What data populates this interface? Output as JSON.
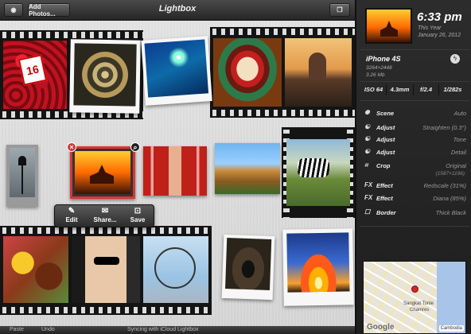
{
  "topbar": {
    "title": "Lightbox",
    "add_photos_label": "Add Photos...",
    "camera_icon": "camera-icon",
    "window_icon": "windows-icon"
  },
  "toolbar": {
    "edit_label": "Edit",
    "share_label": "Share...",
    "save_label": "Save"
  },
  "bottombar": {
    "paste_label": "Paste",
    "undo_label": "Undo",
    "sync_text": "Syncing with iCloud Lightbox"
  },
  "sidebar": {
    "time": "6:33 pm",
    "date_line1": "This Year",
    "date_line2": "January 26, 2012",
    "device": "iPhone 4S",
    "resolution": "3264×2448",
    "filesize": "3.26 Mb",
    "exif": {
      "iso": "ISO 64",
      "focal": "4.3mm",
      "aperture": "f/2.4",
      "shutter": "1/282s"
    },
    "adjustments": [
      {
        "icon": "scene-icon",
        "glyph": "✺",
        "name": "Scene",
        "value": "Auto"
      },
      {
        "icon": "adjust-icon",
        "glyph": "☯",
        "name": "Adjust",
        "value": "Straighten (0.3°)"
      },
      {
        "icon": "adjust-icon",
        "glyph": "☯",
        "name": "Adjust",
        "value": "Tone"
      },
      {
        "icon": "adjust-icon",
        "glyph": "☯",
        "name": "Adjust",
        "value": "Detail"
      },
      {
        "icon": "crop-icon",
        "glyph": "⌗",
        "name": "Crop",
        "value": "Original"
      },
      {
        "icon": "fx-icon",
        "glyph": "FX",
        "name": "Effect",
        "value": "Redscale (31%)"
      },
      {
        "icon": "fx-icon",
        "glyph": "FX",
        "name": "Effect",
        "value": "Diana (85%)"
      },
      {
        "icon": "border-icon",
        "glyph": "☐",
        "name": "Border",
        "value": "Thick Black"
      }
    ],
    "crop_dims": "(1587×1196)",
    "map": {
      "google": "Google",
      "region": "Cambodia",
      "label1": "Sangkat Tonle",
      "label2": "Chamres"
    }
  },
  "colors": {
    "accent_red": "#c83a3a",
    "sidebar_bg": "#262626",
    "canvas_bg": "#dddddd"
  }
}
